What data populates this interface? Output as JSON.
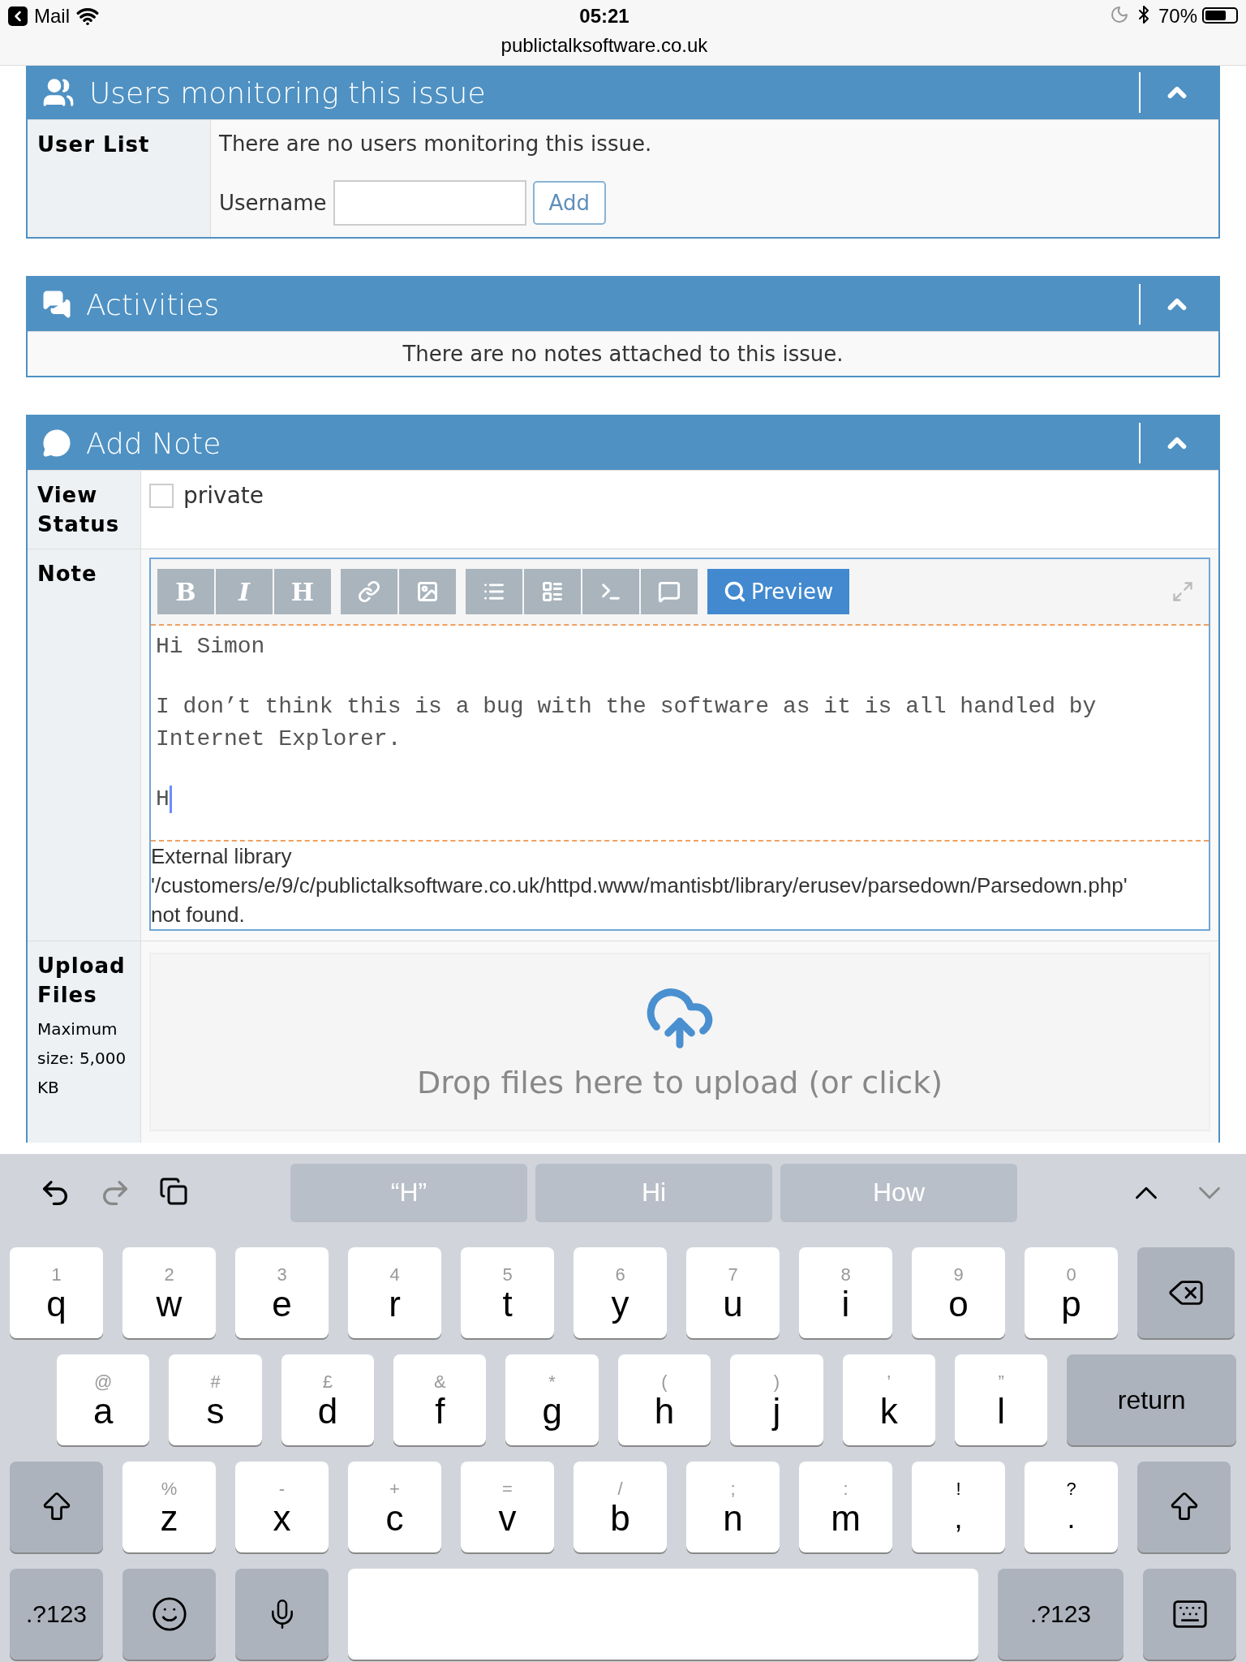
{
  "status_bar": {
    "back_label": "Mail",
    "time": "05:21",
    "url": "publictalksoftware.co.uk",
    "battery_text": "70%"
  },
  "monitor_panel": {
    "title": "Users monitoring this issue",
    "expanded": true,
    "label": "User List",
    "message": "There are no users monitoring this issue.",
    "field_label": "Username",
    "button": "Add"
  },
  "activities_panel": {
    "title": "Activities",
    "expanded": true,
    "message": "There are no notes attached to this issue."
  },
  "note_panel": {
    "title": "Add Note",
    "expanded": true,
    "view_status": {
      "label": "View Status",
      "checkbox_label": "private",
      "checked": false
    },
    "note": {
      "label": "Note",
      "toolbar": [
        {
          "kind": "bold",
          "text": "B"
        },
        {
          "kind": "italic",
          "text": "I"
        },
        {
          "kind": "heading",
          "text": "H"
        },
        {
          "kind": "link"
        },
        {
          "kind": "image"
        },
        {
          "kind": "bullets"
        },
        {
          "kind": "numbered"
        },
        {
          "kind": "code"
        },
        {
          "kind": "quote"
        }
      ],
      "preview": "Preview",
      "paragraphs": [
        "Hi Simon",
        "I don’t think this is a bug with the software as it is all handled by Internet Explorer.",
        "H"
      ],
      "error_lines": [
        "External library",
        "'/customers/e/9/c/publictalksoftware.co.uk/httpd.www/mantisbt/library/erusev/parsedown/Parsedown.php'",
        "not found."
      ]
    },
    "upload": {
      "label": "Upload Files",
      "hint": "Maximum size: 5,000 KB",
      "drop_text": "Drop files here to upload (or click)"
    }
  },
  "keyboard": {
    "suggestions": [
      "“H”",
      "Hi",
      "How"
    ],
    "rows": [
      {
        "keys": [
          {
            "kind": "letter",
            "label": "q",
            "hint": "1"
          },
          {
            "kind": "letter",
            "label": "w",
            "hint": "2"
          },
          {
            "kind": "letter",
            "label": "e",
            "hint": "3"
          },
          {
            "kind": "letter",
            "label": "r",
            "hint": "4"
          },
          {
            "kind": "letter",
            "label": "t",
            "hint": "5"
          },
          {
            "kind": "letter",
            "label": "y",
            "hint": "6"
          },
          {
            "kind": "letter",
            "label": "u",
            "hint": "7"
          },
          {
            "kind": "letter",
            "label": "i",
            "hint": "8"
          },
          {
            "kind": "letter",
            "label": "o",
            "hint": "9"
          },
          {
            "kind": "letter",
            "label": "p",
            "hint": "0"
          },
          {
            "kind": "backspace"
          }
        ]
      },
      {
        "keys": [
          {
            "kind": "letter",
            "label": "a",
            "hint": "@"
          },
          {
            "kind": "letter",
            "label": "s",
            "hint": "#"
          },
          {
            "kind": "letter",
            "label": "d",
            "hint": "£"
          },
          {
            "kind": "letter",
            "label": "f",
            "hint": "&"
          },
          {
            "kind": "letter",
            "label": "g",
            "hint": "*"
          },
          {
            "kind": "letter",
            "label": "h",
            "hint": "("
          },
          {
            "kind": "letter",
            "label": "j",
            "hint": ")"
          },
          {
            "kind": "letter",
            "label": "k",
            "hint": "’"
          },
          {
            "kind": "letter",
            "label": "l",
            "hint": "”"
          },
          {
            "kind": "return",
            "label": "return"
          }
        ]
      },
      {
        "keys": [
          {
            "kind": "shift"
          },
          {
            "kind": "letter",
            "label": "z",
            "hint": "%"
          },
          {
            "kind": "letter",
            "label": "x",
            "hint": "-"
          },
          {
            "kind": "letter",
            "label": "c",
            "hint": "+"
          },
          {
            "kind": "letter",
            "label": "v",
            "hint": "="
          },
          {
            "kind": "letter",
            "label": "b",
            "hint": "/"
          },
          {
            "kind": "letter",
            "label": "n",
            "hint": ";"
          },
          {
            "kind": "letter",
            "label": "m",
            "hint": ":"
          },
          {
            "kind": "punct",
            "label": ",",
            "hint": "!"
          },
          {
            "kind": "punct",
            "label": ".",
            "hint": "?"
          },
          {
            "kind": "shift"
          }
        ]
      },
      {
        "keys": [
          {
            "kind": "mode",
            "label": ".?123"
          },
          {
            "kind": "emoji"
          },
          {
            "kind": "mic"
          },
          {
            "kind": "space"
          },
          {
            "kind": "mode_wide",
            "label": ".?123"
          },
          {
            "kind": "dismiss"
          }
        ]
      }
    ]
  }
}
